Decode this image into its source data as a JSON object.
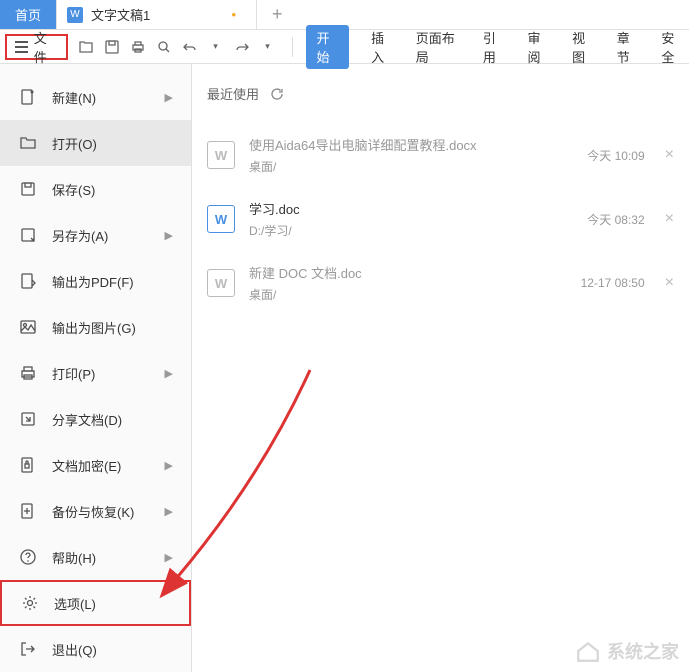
{
  "tabs": {
    "home": "首页",
    "doc": "文字文稿1",
    "modified_dot": "•"
  },
  "file_menu_label": "文件",
  "menu": {
    "start": "开始",
    "insert": "插入",
    "page_layout": "页面布局",
    "reference": "引用",
    "review": "审阅",
    "view": "视图",
    "chapter": "章节",
    "security": "安全"
  },
  "sidebar": {
    "items": [
      {
        "label": "新建(N)",
        "icon": "new",
        "chevron": true
      },
      {
        "label": "打开(O)",
        "icon": "open",
        "active": true
      },
      {
        "label": "保存(S)",
        "icon": "save"
      },
      {
        "label": "另存为(A)",
        "icon": "saveas",
        "chevron": true
      },
      {
        "label": "输出为PDF(F)",
        "icon": "pdf"
      },
      {
        "label": "输出为图片(G)",
        "icon": "image"
      },
      {
        "label": "打印(P)",
        "icon": "print",
        "chevron": true
      },
      {
        "label": "分享文档(D)",
        "icon": "share"
      },
      {
        "label": "文档加密(E)",
        "icon": "encrypt",
        "chevron": true
      },
      {
        "label": "备份与恢复(K)",
        "icon": "backup",
        "chevron": true
      },
      {
        "label": "帮助(H)",
        "icon": "help",
        "chevron": true
      },
      {
        "label": "选项(L)",
        "icon": "options",
        "highlight": true
      },
      {
        "label": "退出(Q)",
        "icon": "exit"
      }
    ]
  },
  "recent_label": "最近使用",
  "files": [
    {
      "name": "使用Aida64导出电脑详细配置教程.docx",
      "path": "桌面/",
      "time": "今天 10:09",
      "dim": true
    },
    {
      "name": "学习.doc",
      "path": "D:/学习/",
      "time": "今天 08:32",
      "dim": false
    },
    {
      "name": "新建 DOC 文档.doc",
      "path": "桌面/",
      "time": "12-17 08:50",
      "dim": true
    }
  ],
  "watermark": "系统之家"
}
